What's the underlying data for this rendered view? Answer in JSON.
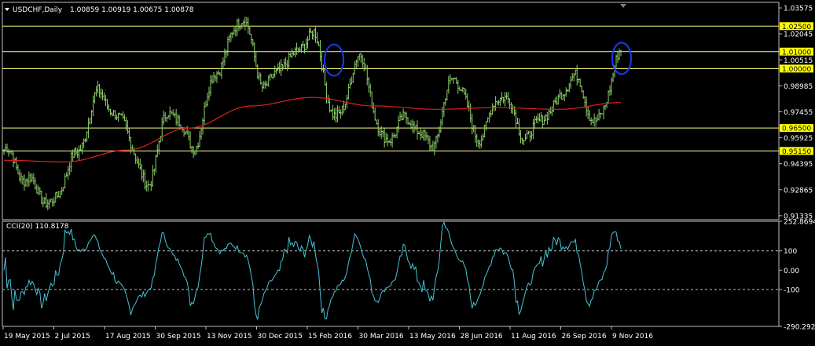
{
  "header": {
    "symbol_label": "USDCHF,Daily",
    "ohlc": "1.00859 1.00919 1.00675 1.00878"
  },
  "indicator_label": "CCI(20) 110.8178",
  "colors": {
    "background": "#000000",
    "frame": "#c0c0c0",
    "price_bars": "#8fd16a",
    "moving_average": "#e02020",
    "cci_line": "#45c4d6",
    "hline": "#ffff80",
    "hline_label_bg": "#ffff00",
    "highlight_circle": "#1a3cf0"
  },
  "chart_data": [
    {
      "type": "ohlc",
      "title": "USDCHF,Daily",
      "ylim": [
        0.911,
        1.039
      ],
      "y_ticks": [
        "1.03575",
        "1.02045",
        "1.00515",
        "0.98985",
        "0.97455",
        "0.95925",
        "0.94395",
        "0.92865",
        "0.91335"
      ],
      "x_ticks": [
        "19 May 2015",
        "2 Jul 2015",
        "17 Aug 2015",
        "30 Sep 2015",
        "13 Nov 2015",
        "30 Dec 2015",
        "15 Feb 2016",
        "30 Mar 2016",
        "13 May 2016",
        "28 Jun 2016",
        "11 Aug 2016",
        "26 Sep 2016",
        "9 Nov 2016"
      ],
      "horizontal_lines": [
        {
          "value": 1.025,
          "label": "1.02500"
        },
        {
          "value": 1.01,
          "label": "1.01000"
        },
        {
          "value": 1.0,
          "label": "1.00000"
        },
        {
          "value": 0.965,
          "label": "0.96500"
        },
        {
          "value": 0.9515,
          "label": "0.95150"
        }
      ],
      "highlight_circles": [
        {
          "date": "mid Feb 2016",
          "price": 1.005
        },
        {
          "date": "mid Nov 2016",
          "price": 1.006
        }
      ],
      "close_path_keypoints": [
        {
          "date": "May 2015",
          "close": 0.952
        },
        {
          "date": "early Jun 2015",
          "close": 0.934
        },
        {
          "date": "mid Jun 2015",
          "close": 0.92
        },
        {
          "date": "Jul 2015",
          "close": 0.948
        },
        {
          "date": "late Jul 2015",
          "close": 0.985
        },
        {
          "date": "Aug 2015",
          "close": 0.968
        },
        {
          "date": "mid Aug 2015",
          "close": 0.932
        },
        {
          "date": "Sep 2015",
          "close": 0.975
        },
        {
          "date": "Oct 2015",
          "close": 0.955
        },
        {
          "date": "early Nov 2015",
          "close": 1.0
        },
        {
          "date": "late Nov 2015",
          "close": 1.03
        },
        {
          "date": "Dec 2015",
          "close": 0.99
        },
        {
          "date": "late Dec 2015",
          "close": 1.005
        },
        {
          "date": "Jan 2016",
          "close": 1.02
        },
        {
          "date": "Feb 2016",
          "close": 0.97
        },
        {
          "date": "mid Feb 2016",
          "close": 1.006
        },
        {
          "date": "Mar 2016",
          "close": 0.958
        },
        {
          "date": "late Mar 2016",
          "close": 0.97
        },
        {
          "date": "Apr 2016",
          "close": 0.955
        },
        {
          "date": "May 2016",
          "close": 0.995
        },
        {
          "date": "Jun 2016",
          "close": 0.96
        },
        {
          "date": "Jul 2016",
          "close": 0.985
        },
        {
          "date": "Aug 2016",
          "close": 0.96
        },
        {
          "date": "Sep 2016",
          "close": 0.975
        },
        {
          "date": "Oct 2016",
          "close": 0.995
        },
        {
          "date": "early Nov 2016",
          "close": 0.968
        },
        {
          "date": "mid Nov 2016",
          "close": 1.0088
        }
      ],
      "moving_average_keypoints": [
        {
          "date": "May 2015",
          "value": 0.946
        },
        {
          "date": "Jul 2015",
          "value": 0.945
        },
        {
          "date": "Sep 2015",
          "value": 0.952
        },
        {
          "date": "Nov 2015",
          "value": 0.965
        },
        {
          "date": "Jan 2016",
          "value": 0.978
        },
        {
          "date": "Feb 2016",
          "value": 0.983
        },
        {
          "date": "Apr 2016",
          "value": 0.978
        },
        {
          "date": "Jun 2016",
          "value": 0.976
        },
        {
          "date": "Aug 2016",
          "value": 0.977
        },
        {
          "date": "Oct 2016",
          "value": 0.976
        },
        {
          "date": "mid Nov 2016",
          "value": 0.98
        }
      ]
    },
    {
      "type": "line",
      "title": "CCI(20) 110.8178",
      "ylim": [
        -290.2926,
        252.8694
      ],
      "y_ticks": [
        "252.8694",
        "100",
        "0.00",
        "-100",
        "-290.2926"
      ],
      "levels": [
        100,
        -100
      ],
      "last_value": 110.8178
    }
  ]
}
